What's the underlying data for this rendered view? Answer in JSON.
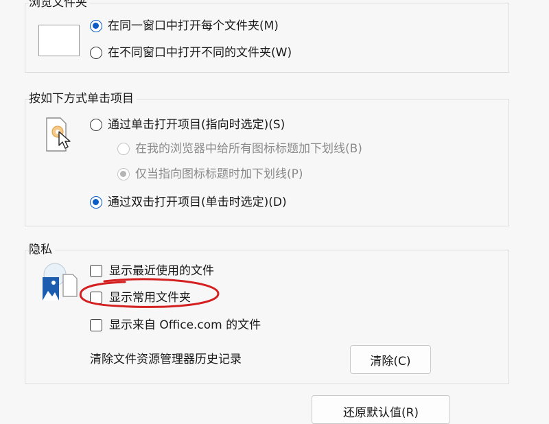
{
  "browse_folders": {
    "title": "浏览文件夹",
    "options": [
      {
        "label": "在同一窗口中打开每个文件夹(M)",
        "checked": true
      },
      {
        "label": "在不同窗口中打开不同的文件夹(W)",
        "checked": false
      }
    ]
  },
  "click_items": {
    "title": "按如下方式单击项目",
    "options": [
      {
        "label": "通过单击打开项目(指向时选定)(S)",
        "checked": false
      },
      {
        "label": "在我的浏览器中给所有图标标题加下划线(B)",
        "checked": false,
        "disabled": true
      },
      {
        "label": "仅当指向图标标题时加下划线(P)",
        "checked": true,
        "disabled": true
      },
      {
        "label": "通过双击打开项目(单击时选定)(D)",
        "checked": true
      }
    ]
  },
  "privacy": {
    "title": "隐私",
    "checks": [
      {
        "label": "显示最近使用的文件",
        "checked": false
      },
      {
        "label": "显示常用文件夹",
        "checked": false
      },
      {
        "label": "显示来自 Office.com 的文件",
        "checked": false
      }
    ],
    "clear_history_label": "清除文件资源管理器历史记录",
    "clear_button": "清除(C)"
  },
  "restore_button": "还原默认值(R)",
  "colors": {
    "accent": "#0a5bc4",
    "annotation": "#d42020"
  }
}
